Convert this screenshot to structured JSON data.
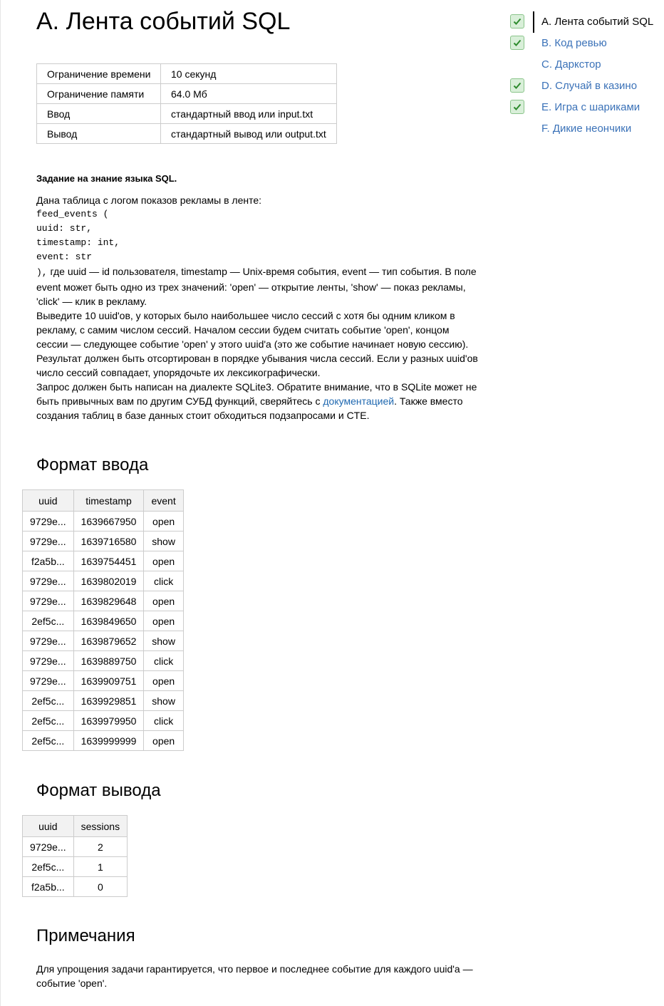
{
  "title": "A. Лента событий SQL",
  "limits": [
    {
      "label": "Ограничение времени",
      "value": "10 секунд"
    },
    {
      "label": "Ограничение памяти",
      "value": "64.0 Мб"
    },
    {
      "label": "Ввод",
      "value": "стандартный ввод или input.txt"
    },
    {
      "label": "Вывод",
      "value": "стандартный вывод или output.txt"
    }
  ],
  "statement": {
    "heading": "Задание на знание языка SQL.",
    "intro": "Дана таблица с логом показов рекламы в ленте:",
    "code_lines": [
      "feed_events (",
      "uuid: str,",
      "timestamp: int,",
      "event: str"
    ],
    "code_close": "),",
    "desc": " где uuid — id пользователя, timestamp — Unix-время события, event — тип события. В поле event может быть одно из трех значений: 'open' — открытие ленты, 'show' — показ рекламы, 'click' — клик в рекламу.",
    "p2": "Выведите 10 uuid'ов, у которых было наибольшее число сессий с хотя бы одним кликом в рекламу, с самим числом сессий. Началом сессии будем считать событие 'open', концом сессии — следующее событие 'open' у этого uuid'а (это же событие начинает новую сессию). Результат должен быть отсортирован в порядке убывания числа сессий. Если у разных uuid'ов число сессий совпадает, упорядочьте их лексикографически.",
    "p3_before": "Запрос должен быть написан на диалекте SQLite3. Обратите внимание, что в SQLite может не быть привычных вам по другим СУБД функций, сверяйтесь с ",
    "p3_link": "документацией",
    "p3_after": ". Также вместо создания таблиц в базе данных стоит обходиться подзапросами и CTE."
  },
  "input_section": {
    "heading": "Формат ввода",
    "columns": [
      "uuid",
      "timestamp",
      "event"
    ],
    "rows": [
      [
        "9729e...",
        "1639667950",
        "open"
      ],
      [
        "9729e...",
        "1639716580",
        "show"
      ],
      [
        "f2a5b...",
        "1639754451",
        "open"
      ],
      [
        "9729e...",
        "1639802019",
        "click"
      ],
      [
        "9729e...",
        "1639829648",
        "open"
      ],
      [
        "2ef5c...",
        "1639849650",
        "open"
      ],
      [
        "9729e...",
        "1639879652",
        "show"
      ],
      [
        "9729e...",
        "1639889750",
        "click"
      ],
      [
        "9729e...",
        "1639909751",
        "open"
      ],
      [
        "2ef5c...",
        "1639929851",
        "show"
      ],
      [
        "2ef5c...",
        "1639979950",
        "click"
      ],
      [
        "2ef5c...",
        "1639999999",
        "open"
      ]
    ]
  },
  "output_section": {
    "heading": "Формат вывода",
    "columns": [
      "uuid",
      "sessions"
    ],
    "rows": [
      [
        "9729e...",
        "2"
      ],
      [
        "2ef5c...",
        "1"
      ],
      [
        "f2a5b...",
        "0"
      ]
    ]
  },
  "notes": {
    "heading": "Примечания",
    "text": "Для упрощения задачи гарантируется, что первое и последнее событие для каждого uuid'а — событие 'open'."
  },
  "toc": [
    {
      "label": "A. Лента событий SQL",
      "checked": true,
      "active": true
    },
    {
      "label": "B. Код ревью",
      "checked": true,
      "active": false
    },
    {
      "label": "C. Даркстор",
      "checked": false,
      "active": false
    },
    {
      "label": "D. Случай в казино",
      "checked": true,
      "active": false
    },
    {
      "label": "E. Игра с шариками",
      "checked": true,
      "active": false
    },
    {
      "label": "F. Дикие неончики",
      "checked": false,
      "active": false
    }
  ],
  "colors": {
    "link": "#1f68b0",
    "toc_link": "#3b72b8",
    "check_bg": "#d9efd9",
    "check_mark": "#2e8b2e"
  }
}
